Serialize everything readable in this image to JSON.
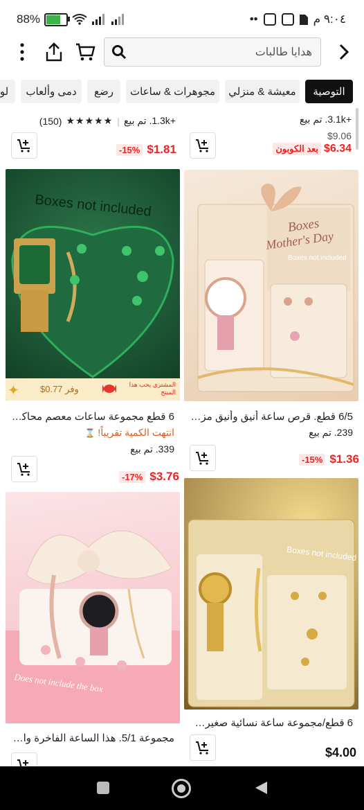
{
  "status": {
    "battery": "88%",
    "time": "٩:٠٤ م",
    "dots": "••"
  },
  "search": {
    "placeholder": "هدايا طالبات"
  },
  "tabs": [
    "التوصية",
    "معيشة & منزلي",
    "مجوهرات & ساعات",
    "رضع",
    "دمى وألعاب",
    "لو"
  ],
  "products": [
    {
      "sold": "+3.1k. تم بيع",
      "orig_price": "$9.06",
      "price": "$6.34",
      "coupon": "بعد الكوبون"
    },
    {
      "sold": "+1.3k. تم بيع",
      "reviews": "(150)",
      "price": "$1.81",
      "discount": "-15%"
    },
    {
      "img_text1": "Boxes",
      "img_text2": "Mother's Day",
      "img_text3": "Boxes not included",
      "title": "6/5 قطع. قرص ساعة أنيق وأنيق مزين...",
      "sold": "239. تم بيع",
      "price": "$1.36",
      "discount": "-15%"
    },
    {
      "img_text1": "Boxes not included",
      "promo_text": "وفر 0.77$",
      "promo_small": "المشتري يحب هذا المنتج",
      "title": "6 قطع مجموعة ساعات معصم محاكاة ...",
      "low_stock": "انتهت الكمية تقريباً!",
      "sold": "339. تم بيع",
      "price": "$3.76",
      "discount": "-17%"
    },
    {
      "img_text1": "Boxes not included",
      "title": "6 قطع/مجموعة ساعة نسائية صغيرة ذ...",
      "price": "$4.00"
    },
    {
      "img_text1": "Does not include the box",
      "title": "مجموعة 5/1. هذا الساعة الفاخرة والأن..."
    }
  ],
  "colors": {
    "red": "#e22222",
    "green": "#1d5a35",
    "cream": "#f3e3d0",
    "pink": "#f4c9cf",
    "gold": "#d9b86a"
  }
}
